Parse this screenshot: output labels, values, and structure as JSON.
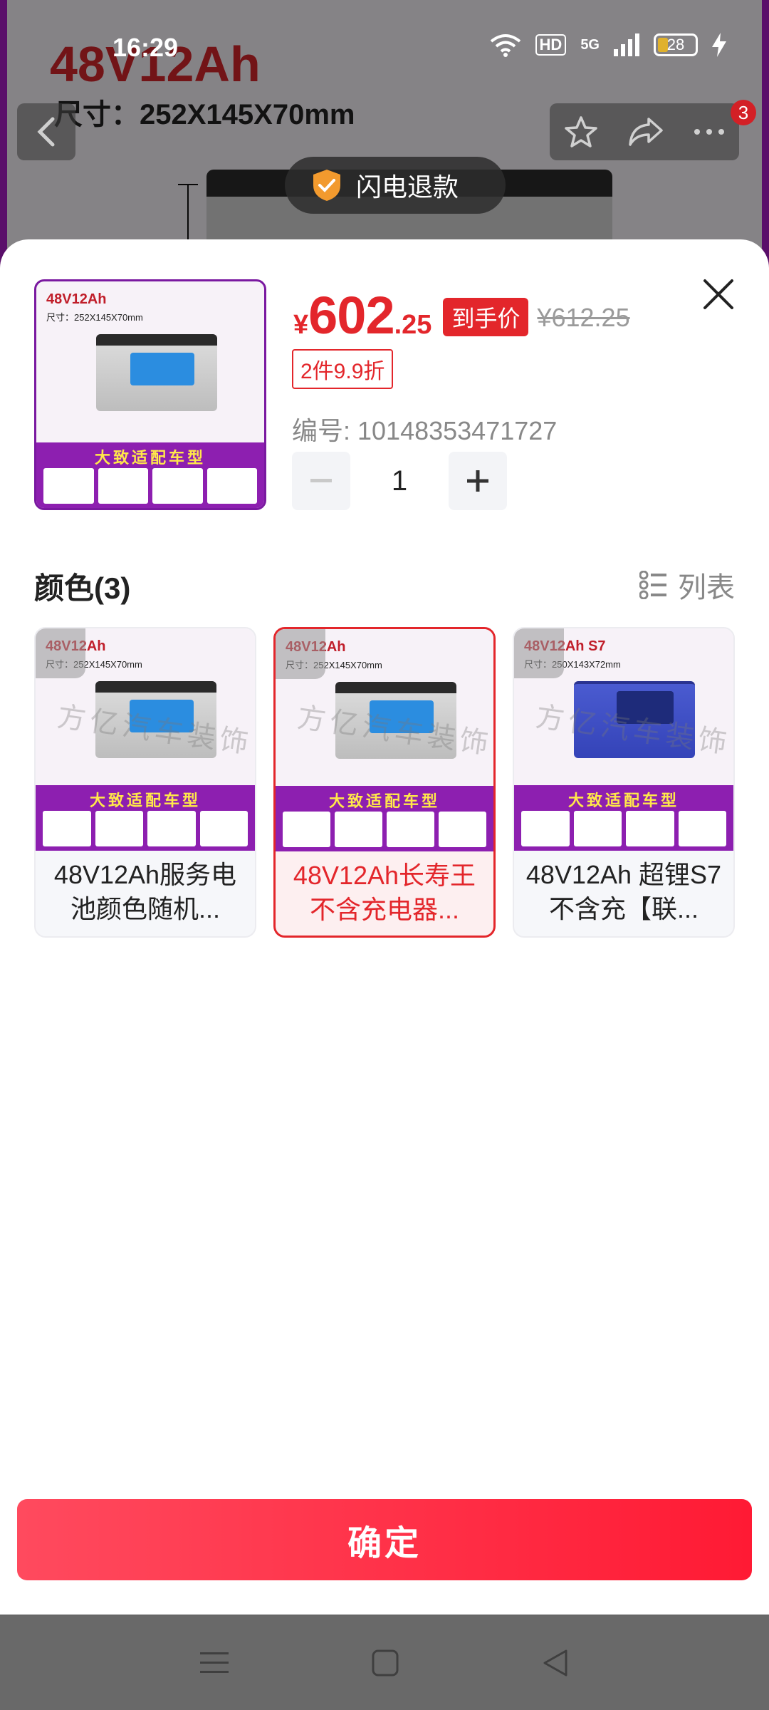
{
  "status_bar": {
    "time": "16:29",
    "hd": "HD",
    "network": "5G",
    "battery": "28"
  },
  "background": {
    "title": "48V12Ah",
    "size": "尺寸：252X145X70mm",
    "refund_badge": "闪电退款",
    "cart_count": "3"
  },
  "product": {
    "price_symbol": "¥",
    "price_integer": "602",
    "price_decimal": ".25",
    "final_price_tag": "到手价",
    "original_price": "¥612.25",
    "discount": "2件9.9折",
    "item_number": "编号: 10148353471727",
    "quantity": "1",
    "thumb_title": "48V12Ah",
    "thumb_size": "尺寸：252X145X70mm",
    "thumb_band": "大致适配车型"
  },
  "options_section": {
    "title": "颜色(3)",
    "list_toggle": "列表",
    "options": [
      {
        "label": "48V12Ah服务电池颜色随机...",
        "art_title": "48V12Ah",
        "art_size": "尺寸：252X145X70mm",
        "band": "大致适配车型",
        "watermark": "方亿汽车装饰"
      },
      {
        "label": "48V12Ah长寿王不含充电器...",
        "art_title": "48V12Ah",
        "art_size": "尺寸：252X145X70mm",
        "band": "大致适配车型",
        "watermark": "方亿汽车装饰"
      },
      {
        "label": "48V12Ah 超锂S7不含充【联...",
        "art_title": "48V12Ah S7",
        "art_size": "尺寸：250X143X72mm",
        "band": "大致适配车型",
        "watermark": "方亿汽车装饰"
      }
    ],
    "selected_index": 1
  },
  "confirm_label": "确定",
  "colors": {
    "accent": "#e3262b",
    "confirm_gradient_start": "#ff4a5e",
    "confirm_gradient_end": "#ff1a34",
    "band": "#8d1fb0"
  },
  "icons": [
    "back-icon",
    "star-icon",
    "share-icon",
    "more-icon",
    "shield-check-icon",
    "close-icon",
    "minus-icon",
    "plus-icon",
    "list-icon",
    "menu-icon",
    "home-icon",
    "back-triangle-icon"
  ]
}
